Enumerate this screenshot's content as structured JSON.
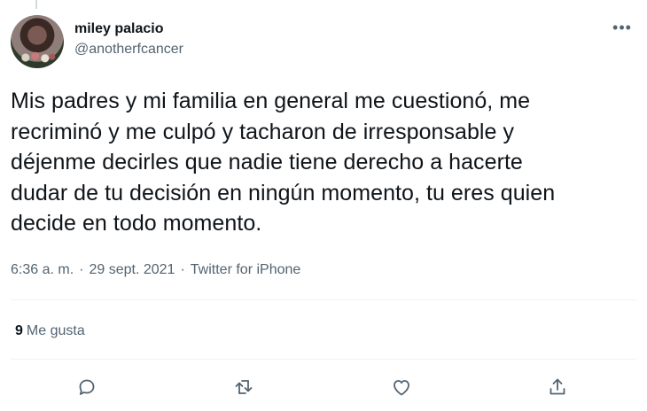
{
  "tweet": {
    "display_name": "miley palacio",
    "handle": "@anotherfcancer",
    "text_lines": [
      "Mis padres y mi familia en general me cuestionó, me",
      "recriminó y me culpó y tacharon de irresponsable y",
      "déjenme decirles que nadie tiene derecho a hacerte",
      "dudar de tu decisión en ningún momento, tu eres quien",
      "decide en todo momento."
    ],
    "time": "6:36 a. m.",
    "date": "29 sept. 2021",
    "source": "Twitter for iPhone",
    "separator": "·",
    "more_glyph": "•••"
  },
  "stats": {
    "likes_count": "9",
    "likes_label": "Me gusta"
  },
  "actions": [
    {
      "icon": "reply-icon"
    },
    {
      "icon": "retweet-icon"
    },
    {
      "icon": "like-icon"
    },
    {
      "icon": "share-icon"
    }
  ],
  "colors": {
    "text": "#0f1419",
    "secondary": "#536471",
    "divider": "#eff3f4"
  }
}
